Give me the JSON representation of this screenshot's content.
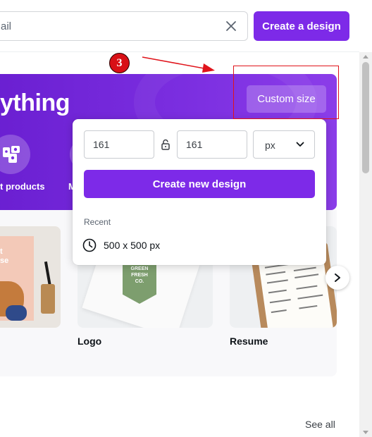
{
  "header": {
    "search_text": "ail",
    "create_button": "Create a design"
  },
  "hero": {
    "title": "ything",
    "custom_size_button": "Custom size",
    "category_1_label": "t products",
    "category_2_label": "M"
  },
  "annotation": {
    "step_number": "3",
    "color": "#e0141b"
  },
  "custom_size_popover": {
    "width_value": "161",
    "height_value": "161",
    "unit_selected": "px",
    "create_button": "Create new design",
    "recent_label": "Recent",
    "recent_items": [
      "500 x 500 px"
    ]
  },
  "templates": [
    {
      "label": "",
      "poster_text": "t\nse"
    },
    {
      "label": "Logo",
      "tag_text": "GREEN FRESH CO."
    },
    {
      "label": "Resume"
    }
  ],
  "footer": {
    "see_all": "See all"
  },
  "colors": {
    "brand_purple": "#7d2ae8",
    "hero_gradient_start": "#6a1fd1",
    "hero_gradient_end": "#8b3de9"
  }
}
